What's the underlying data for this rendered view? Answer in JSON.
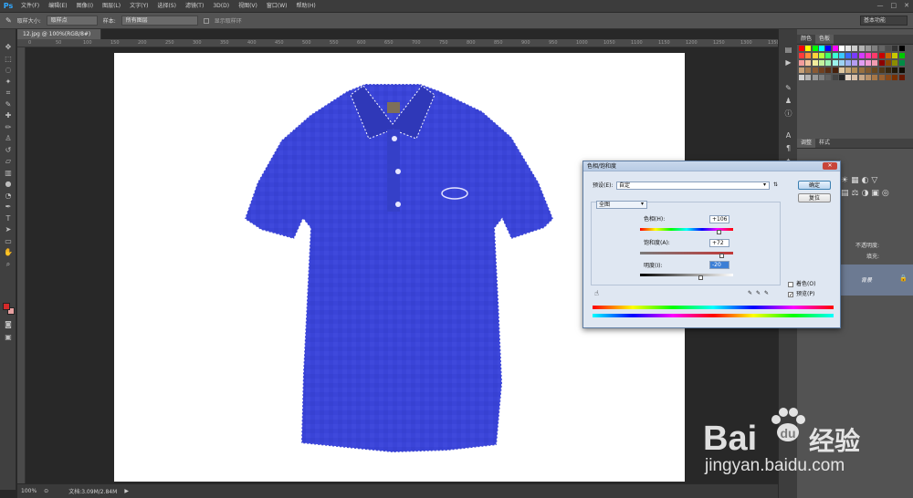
{
  "app": {
    "logo": "Ps"
  },
  "menu": [
    "文件(F)",
    "编辑(E)",
    "图像(I)",
    "图层(L)",
    "文字(Y)",
    "选择(S)",
    "滤镜(T)",
    "3D(D)",
    "视图(V)",
    "窗口(W)",
    "帮助(H)"
  ],
  "window_controls": [
    "—",
    "□",
    "✕"
  ],
  "options_bar": {
    "sample_size_label": "取样大小:",
    "sample_size_value": "取样点",
    "sample_label": "样本:",
    "sample_value": "所有图层",
    "show_ring": "显示取样环",
    "workspace": "基本功能"
  },
  "document": {
    "tab_title": "12.jpg @ 100%(RGB/8#)",
    "zoom": "100%",
    "doc_info": "文档:3.09M/2.84M"
  },
  "ruler_top": [
    "0",
    "50",
    "100",
    "150",
    "200",
    "250",
    "300",
    "350",
    "400",
    "450",
    "500",
    "550",
    "600",
    "650",
    "700",
    "750",
    "800",
    "850",
    "900",
    "950",
    "1000",
    "1050",
    "1100",
    "1150",
    "1200",
    "1250",
    "1300",
    "1350"
  ],
  "right_panel": {
    "color_tabs": [
      "颜色",
      "色板"
    ],
    "adjust_tabs": [
      "调整",
      "样式"
    ],
    "opacity_label": "不透明度:",
    "fill_label": "填充:",
    "layer_name": "背景"
  },
  "dialog": {
    "title": "色相/饱和度",
    "preset_label": "预设(E):",
    "preset_value": "自定",
    "ok": "确定",
    "reset": "复位",
    "channel": "全图",
    "hue_label": "色相(H):",
    "hue_value": "+106",
    "sat_label": "饱和度(A):",
    "sat_value": "+72",
    "light_label": "明度(I):",
    "light_value": "-20",
    "colorize": "着色(O)",
    "preview": "预览(P)"
  },
  "watermark": {
    "brand": "Bai",
    "brand2": "经验",
    "url": "jingyan.baidu.com"
  },
  "colors": {
    "shirt": "#3a44d8",
    "shirt_dark": "#2f38b8",
    "accent": "#31a8ff",
    "fg": "#d42a2a",
    "bg": "#ffffff"
  }
}
